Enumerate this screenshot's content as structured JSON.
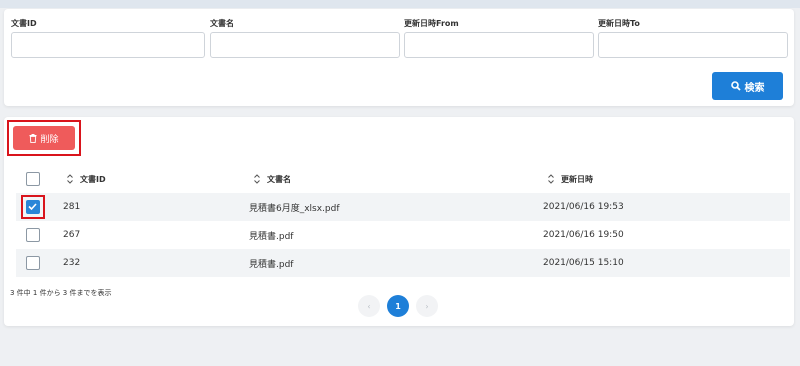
{
  "search": {
    "fields": [
      {
        "label": "文書ID",
        "value": "",
        "placeholder": ""
      },
      {
        "label": "文書名",
        "value": "",
        "placeholder": ""
      },
      {
        "label": "更新日時From",
        "value": "",
        "placeholder": ""
      },
      {
        "label": "更新日時To",
        "value": "",
        "placeholder": ""
      }
    ],
    "button_label": "検索"
  },
  "actions": {
    "delete_label": "削除"
  },
  "table": {
    "headers": {
      "id": "文書ID",
      "name": "文書名",
      "updated": "更新日時"
    },
    "rows": [
      {
        "id": "281",
        "name": "見積書6月度_xlsx.pdf",
        "updated": "2021/06/16 19:53",
        "checked": true
      },
      {
        "id": "267",
        "name": "見積書.pdf",
        "updated": "2021/06/16 19:50",
        "checked": false
      },
      {
        "id": "232",
        "name": "見積書.pdf",
        "updated": "2021/06/15 15:10",
        "checked": false
      }
    ]
  },
  "summary": "3 件中 1 件から 3 件までを表示",
  "pagination": {
    "prev": "‹",
    "current": "1",
    "next": "›"
  },
  "colors": {
    "primary": "#1e7fd8",
    "danger": "#ef5b5b",
    "highlight": "#d9141c"
  }
}
